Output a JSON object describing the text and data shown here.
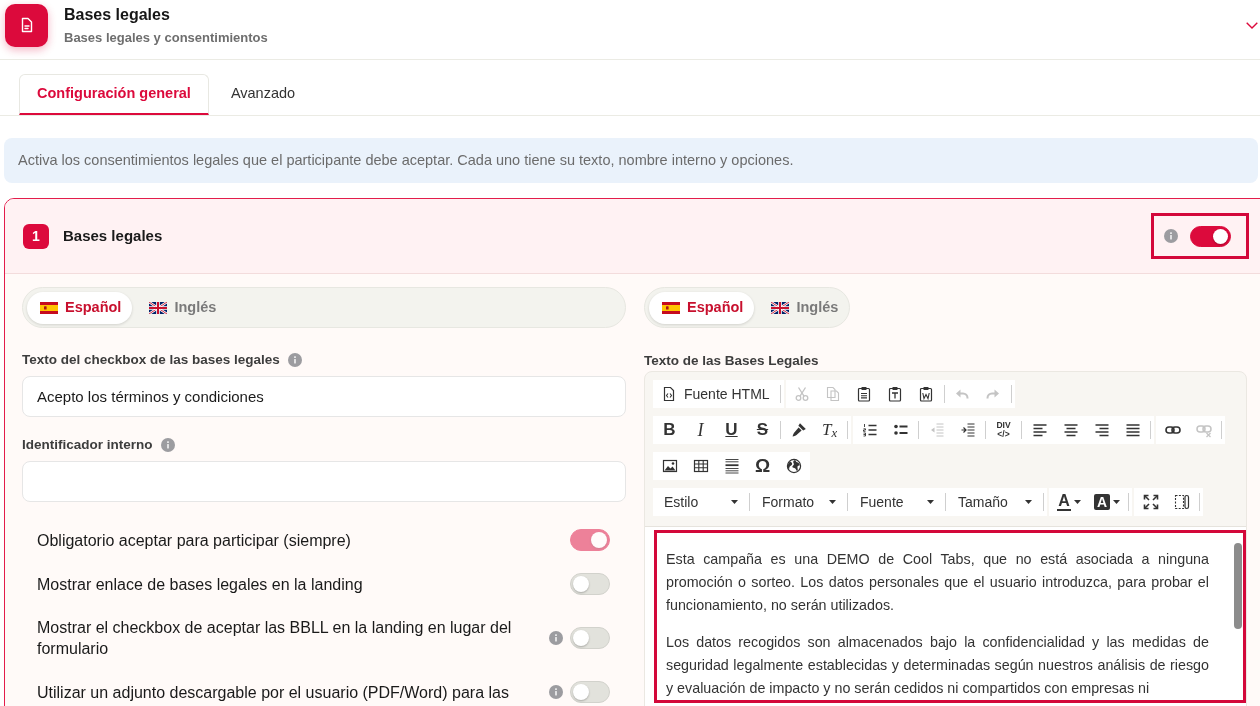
{
  "header": {
    "title": "Bases legales",
    "subtitle": "Bases legales y consentimientos"
  },
  "tabs": [
    {
      "label": "Configuración general",
      "selected": true
    },
    {
      "label": "Avanzado",
      "selected": false
    }
  ],
  "info_banner": {
    "text": "Activa los consentimientos legales que el participante debe aceptar. Cada uno tiene su texto, nombre interno y opciones."
  },
  "consent": {
    "number": "1",
    "title": "Bases legales",
    "enabled": true,
    "highlighted": true,
    "languages": [
      {
        "label": "Español",
        "kind": "es",
        "selected": true
      },
      {
        "label": "Inglés",
        "kind": "gb",
        "selected": false
      }
    ],
    "fields": [
      {
        "label": "Texto del checkbox de las bases legales",
        "info": true,
        "value": "Acepto los términos y condiciones"
      },
      {
        "label": "Identificador interno",
        "info": true
      }
    ],
    "options": [
      {
        "label": "Obligatorio aceptar para participar (siempre)",
        "info": false,
        "on": true,
        "disabled": true
      },
      {
        "label": "Mostrar enlace de bases legales en la landing",
        "info": false,
        "on": false,
        "disabled": false
      },
      {
        "label": "Mostrar el checkbox de aceptar las BBLL en la landing en lugar del formulario",
        "info": true,
        "on": false,
        "disabled": false
      },
      {
        "label": "Utilizar un adjunto descargable por el usuario (PDF/Word) para las",
        "info": true,
        "on": false,
        "disabled": false
      }
    ],
    "text_panel": {
      "languages": [
        {
          "label": "Español",
          "kind": "es",
          "selected": true
        },
        {
          "label": "Inglés",
          "kind": "gb",
          "selected": false
        }
      ],
      "label": "Texto de las Bases Legales",
      "toolbar": [
        [
          [
            [
              {
                "kind": "source",
                "label": "Fuente HTML",
                "disabled": false
              }
            ]
          ],
          [
            [
              {
                "kind": "cut",
                "disabled": true
              },
              {
                "kind": "copy",
                "disabled": true
              },
              {
                "kind": "paste",
                "disabled": false
              },
              {
                "kind": "paste-text",
                "disabled": false
              },
              {
                "kind": "paste-word",
                "disabled": false
              }
            ],
            [
              {
                "kind": "undo",
                "disabled": true
              },
              {
                "kind": "redo",
                "disabled": true
              }
            ]
          ]
        ],
        [
          [
            [
              {
                "kind": "bold",
                "label": "B",
                "disabled": false
              },
              {
                "kind": "italic",
                "label": "I",
                "disabled": false
              },
              {
                "kind": "underline",
                "label": "U",
                "disabled": false
              },
              {
                "kind": "strike",
                "label": "S",
                "disabled": false
              }
            ],
            [
              {
                "kind": "brush",
                "disabled": false
              },
              {
                "kind": "clear-format",
                "label": "T$_{x}$",
                "disabled": false
              }
            ]
          ],
          [
            [
              {
                "kind": "ol",
                "disabled": false
              },
              {
                "kind": "ul",
                "disabled": false
              }
            ],
            [
              {
                "kind": "outdent",
                "disabled": true
              },
              {
                "kind": "indent",
                "disabled": false
              }
            ],
            [
              {
                "kind": "div",
                "label": "DIV",
                "sublabel": "</>",
                "disabled": false
              }
            ],
            [
              {
                "kind": "align-left",
                "disabled": false
              },
              {
                "kind": "align-center",
                "disabled": false
              },
              {
                "kind": "align-right",
                "disabled": false
              },
              {
                "kind": "align-justify",
                "disabled": false
              }
            ]
          ],
          [
            [
              {
                "kind": "link",
                "disabled": false
              },
              {
                "kind": "unlink",
                "disabled": true
              }
            ]
          ]
        ],
        [
          [
            [
              {
                "kind": "image",
                "disabled": false
              },
              {
                "kind": "table",
                "disabled": false
              },
              {
                "kind": "hr",
                "disabled": false
              },
              {
                "kind": "special-char",
                "label": "Ω",
                "disabled": false
              },
              {
                "kind": "globe",
                "disabled": false
              }
            ]
          ]
        ],
        [
          [
            [
              {
                "kind": "combo",
                "label": "Estilo",
                "disabled": false
              }
            ],
            [
              {
                "kind": "combo",
                "label": "Formato",
                "disabled": false
              }
            ],
            [
              {
                "kind": "combo",
                "label": "Fuente",
                "disabled": false
              }
            ],
            [
              {
                "kind": "combo",
                "label": "Tamaño",
                "disabled": false
              }
            ]
          ],
          [
            [
              {
                "kind": "text-color",
                "label": "A",
                "disabled": false
              },
              {
                "kind": "bg-color",
                "label": "A",
                "disabled": false
              }
            ]
          ],
          [
            [
              {
                "kind": "maximize",
                "disabled": false
              },
              {
                "kind": "showblocks",
                "disabled": false
              }
            ]
          ]
        ]
      ],
      "highlighted": true,
      "paragraphs": [
        "Esta campaña es una DEMO de Cool Tabs, que no está asociada a ninguna promoción o sorteo. Los datos personales que el usuario introduzca, para probar el funcionamiento, no serán utilizados.",
        "Los datos recogidos son almacenados bajo la confidencialidad y las medidas de seguridad legalmente establecidas y determinadas según nuestros análisis de riesgo y evaluación de impacto y no serán cedidos ni compartidos con empresas ni"
      ]
    }
  }
}
